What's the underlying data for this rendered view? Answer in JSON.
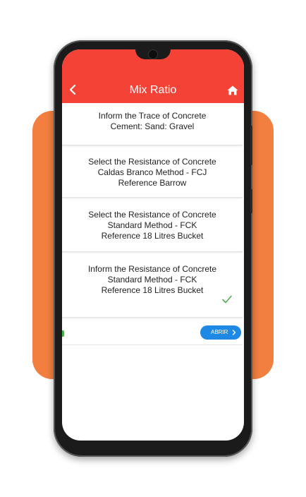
{
  "app": {
    "title": "Mix Ratio",
    "accent_color": "#f44336",
    "back_icon": "chevron-left-icon",
    "home_icon": "home-icon"
  },
  "options": [
    {
      "lines": [
        "Inform the Trace of Concrete",
        "Cement: Sand: Gravel"
      ],
      "checked": false
    },
    {
      "lines": [
        "Select the Resistance  of Concrete",
        "Caldas Branco Method - FCJ",
        "Reference Barrow"
      ],
      "checked": false
    },
    {
      "lines": [
        "Select the Resistance  of Concrete",
        "Standard Method - FCK",
        "Reference 18 Litres Bucket"
      ],
      "checked": false
    },
    {
      "lines": [
        "Inform the Resistance of Concrete",
        "Standard Method - FCK",
        "Reference 18 Litres Bucket"
      ],
      "checked": true
    }
  ],
  "footer": {
    "open_label": "ABRIR",
    "button_color": "#1e88e5"
  }
}
